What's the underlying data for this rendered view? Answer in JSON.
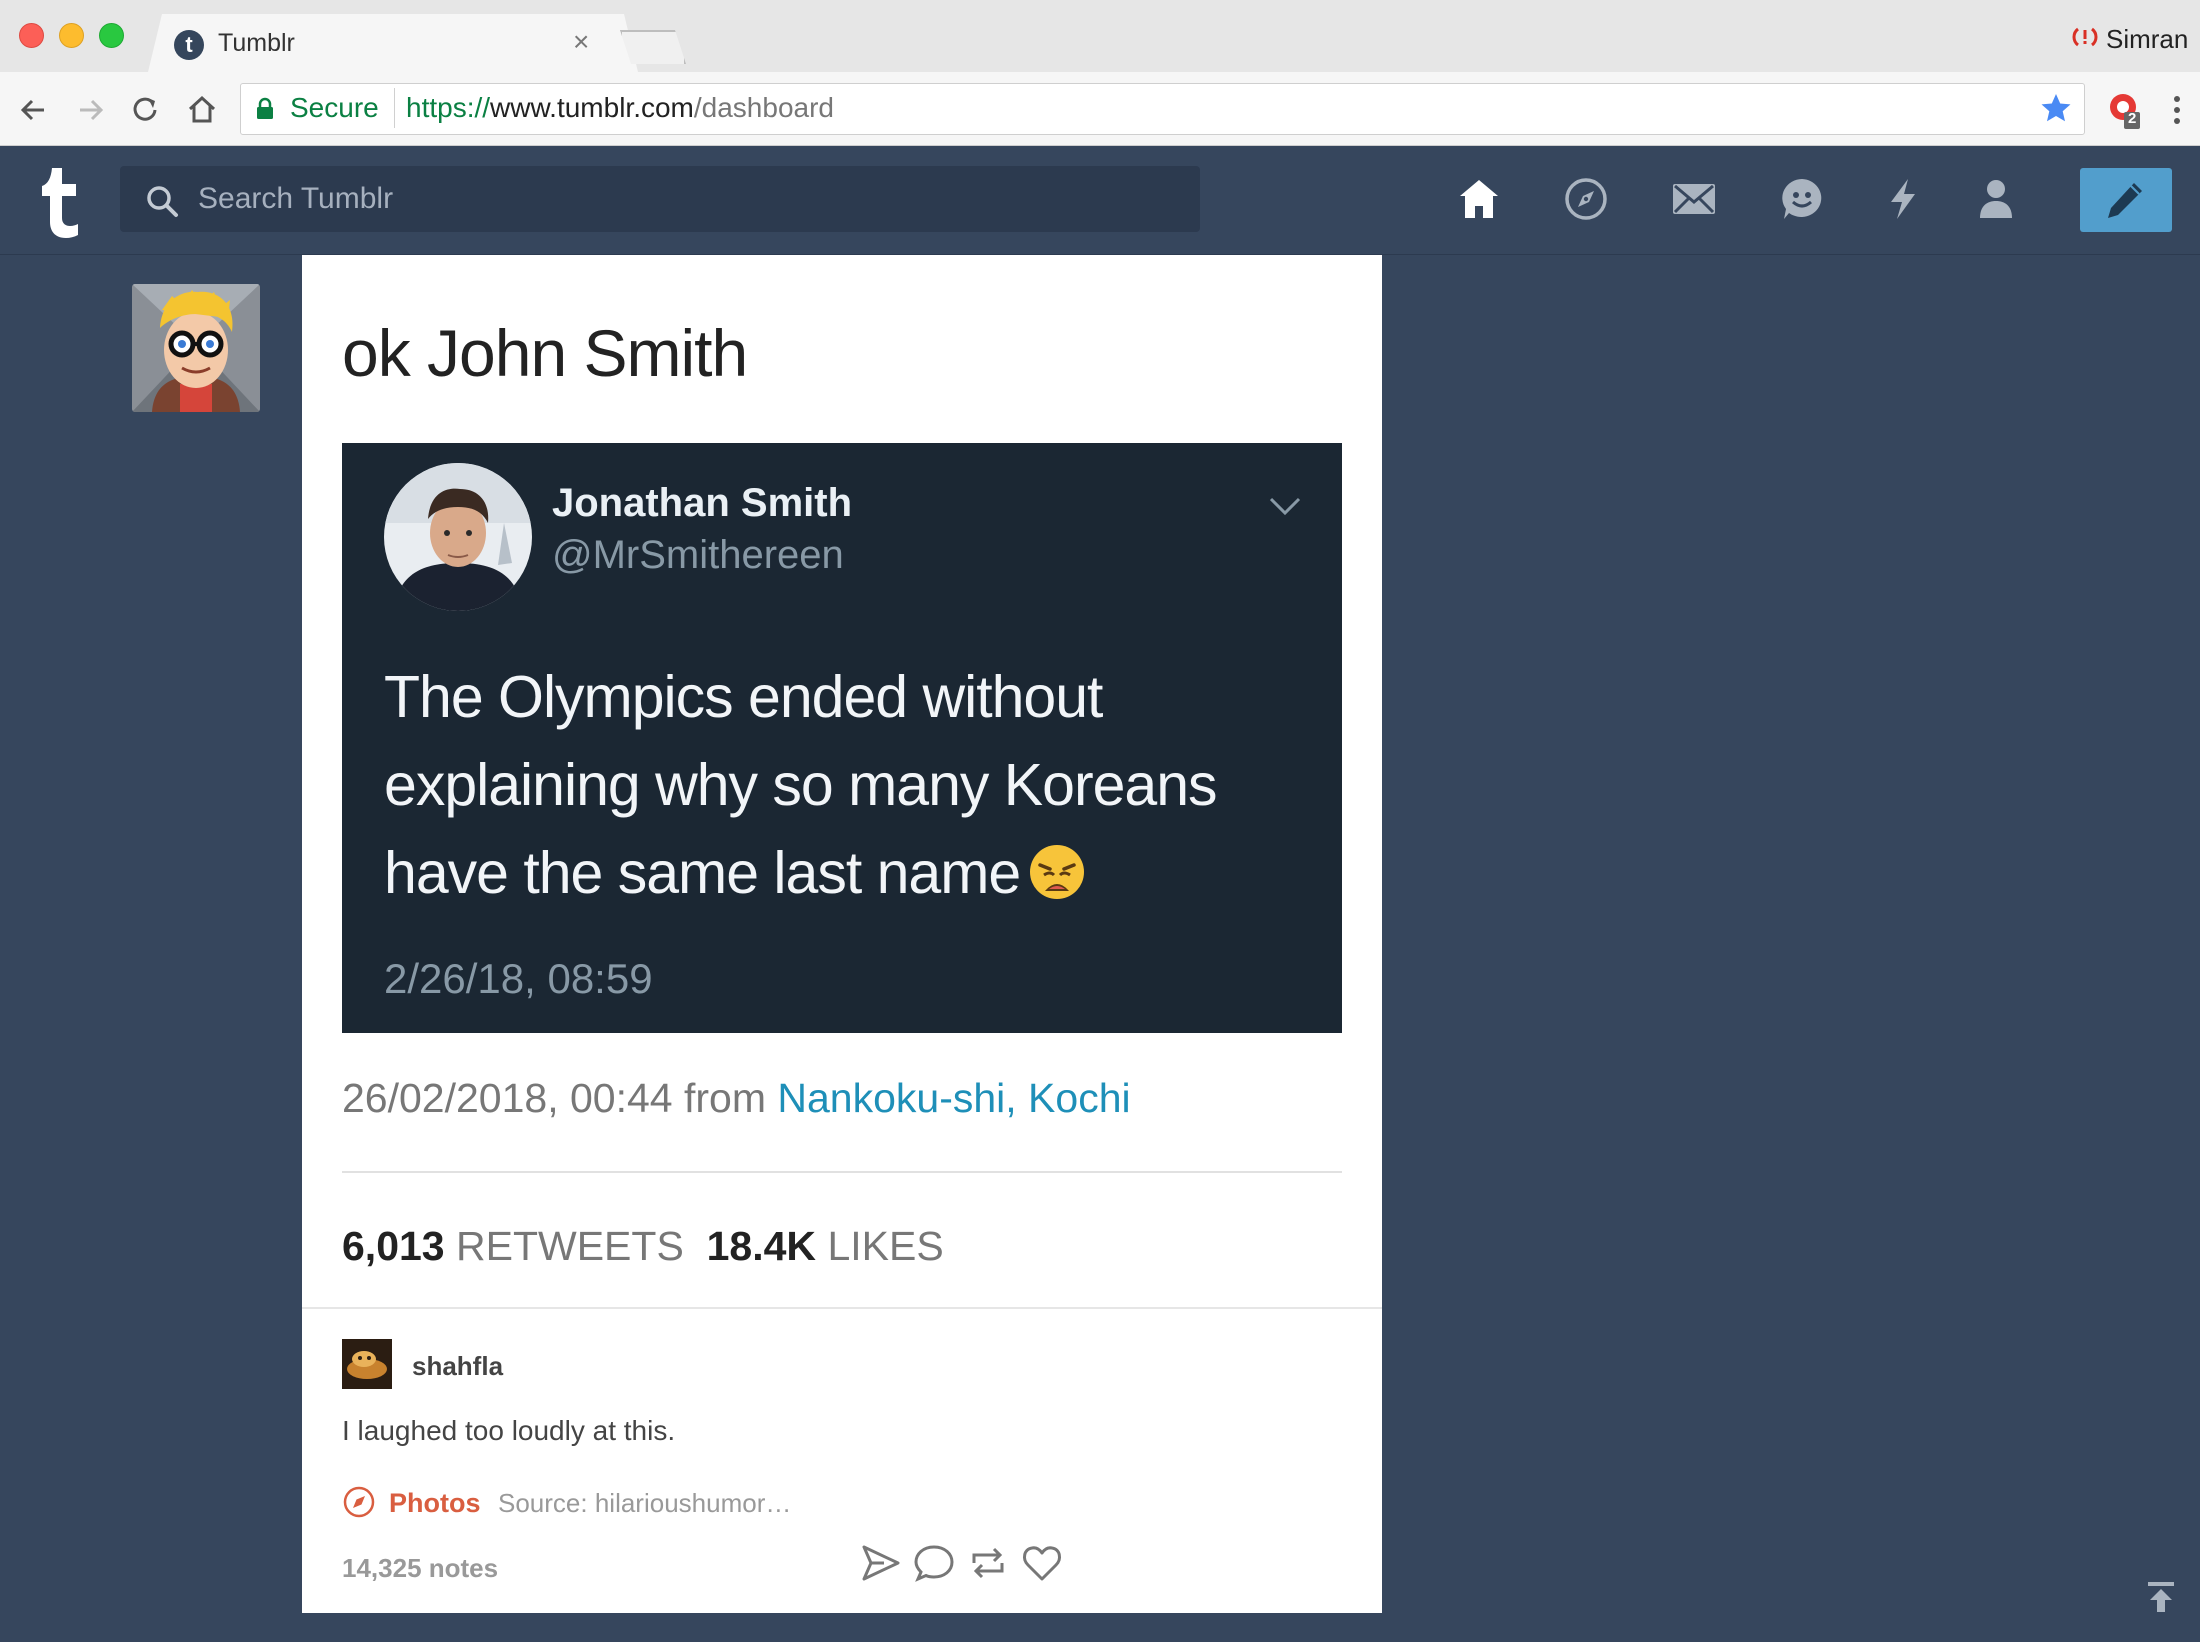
{
  "browser": {
    "tab_title": "Tumblr",
    "tab_close": "×",
    "profile_name": "Simran",
    "secure_label": "Secure",
    "url_scheme": "https://",
    "url_host": "www.tumblr.com",
    "url_path": "/dashboard",
    "extension_badge": "2"
  },
  "header": {
    "search_placeholder": "Search Tumblr",
    "accent": "#529ecc",
    "background": "#36465d"
  },
  "post": {
    "title": "ok John Smith",
    "tweet": {
      "name": "Jonathan Smith",
      "handle": "@MrSmithereen",
      "text_lines": [
        "The Olympics ended without",
        "explaining why so many Koreans",
        "have the same last name"
      ],
      "time": "2/26/18, 08:59"
    },
    "meta": {
      "datetime": "26/02/2018, 00:44 from ",
      "location": "Nankoku-shi, Kochi"
    },
    "stats": {
      "retweets_count": "6,013",
      "retweets_label": "RETWEETS",
      "likes_count": "18.4K",
      "likes_label": "LIKES"
    },
    "reblog": {
      "username": "shahfla",
      "comment": "I laughed too loudly at this."
    },
    "footer": {
      "tag_label": "Photos",
      "source": "Source: hilarioushumor…",
      "notes": "14,325 notes"
    }
  }
}
